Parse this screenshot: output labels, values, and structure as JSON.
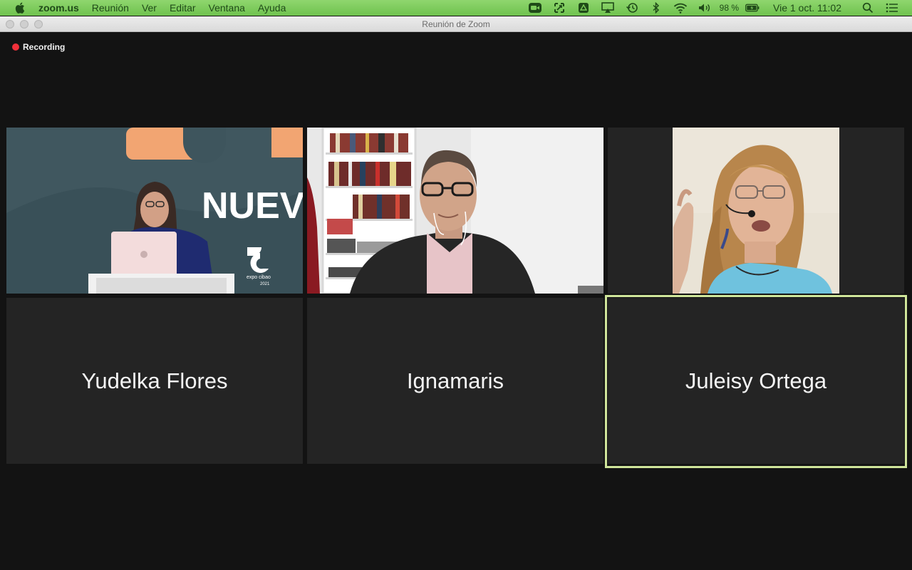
{
  "menubar": {
    "app_name": "zoom.us",
    "items": [
      "Reunión",
      "Ver",
      "Editar",
      "Ventana",
      "Ayuda"
    ],
    "status_icons": [
      "zoom-camera-icon",
      "screenshot-tool-icon",
      "drive-icon",
      "airplay-icon",
      "time-machine-icon",
      "bluetooth-icon",
      "wifi-icon",
      "volume-icon"
    ],
    "battery": "98 %",
    "datetime": "Vie 1 oct.  11:02"
  },
  "window": {
    "title": "Reunión de Zoom"
  },
  "meeting": {
    "recording_label": "Recording",
    "video_tiles": [
      {
        "content": "presenter at lectern with laptop, stage backdrop",
        "backdrop_text": "NUEV",
        "logo_text": "expo cibao",
        "logo_year": "2021"
      },
      {
        "content": "man with glasses in front of bookshelf"
      },
      {
        "content": "woman with headset microphone speaking"
      }
    ],
    "name_tiles": [
      {
        "name": "Yudelka Flores",
        "active": false
      },
      {
        "name": "Ignamaris",
        "active": false
      },
      {
        "name": "Juleisy Ortega",
        "active": true
      }
    ],
    "colors": {
      "active_speaker_border": "#cfe59a",
      "recording_dot": "#f0303a",
      "menubar": "#7ccb5b"
    }
  }
}
